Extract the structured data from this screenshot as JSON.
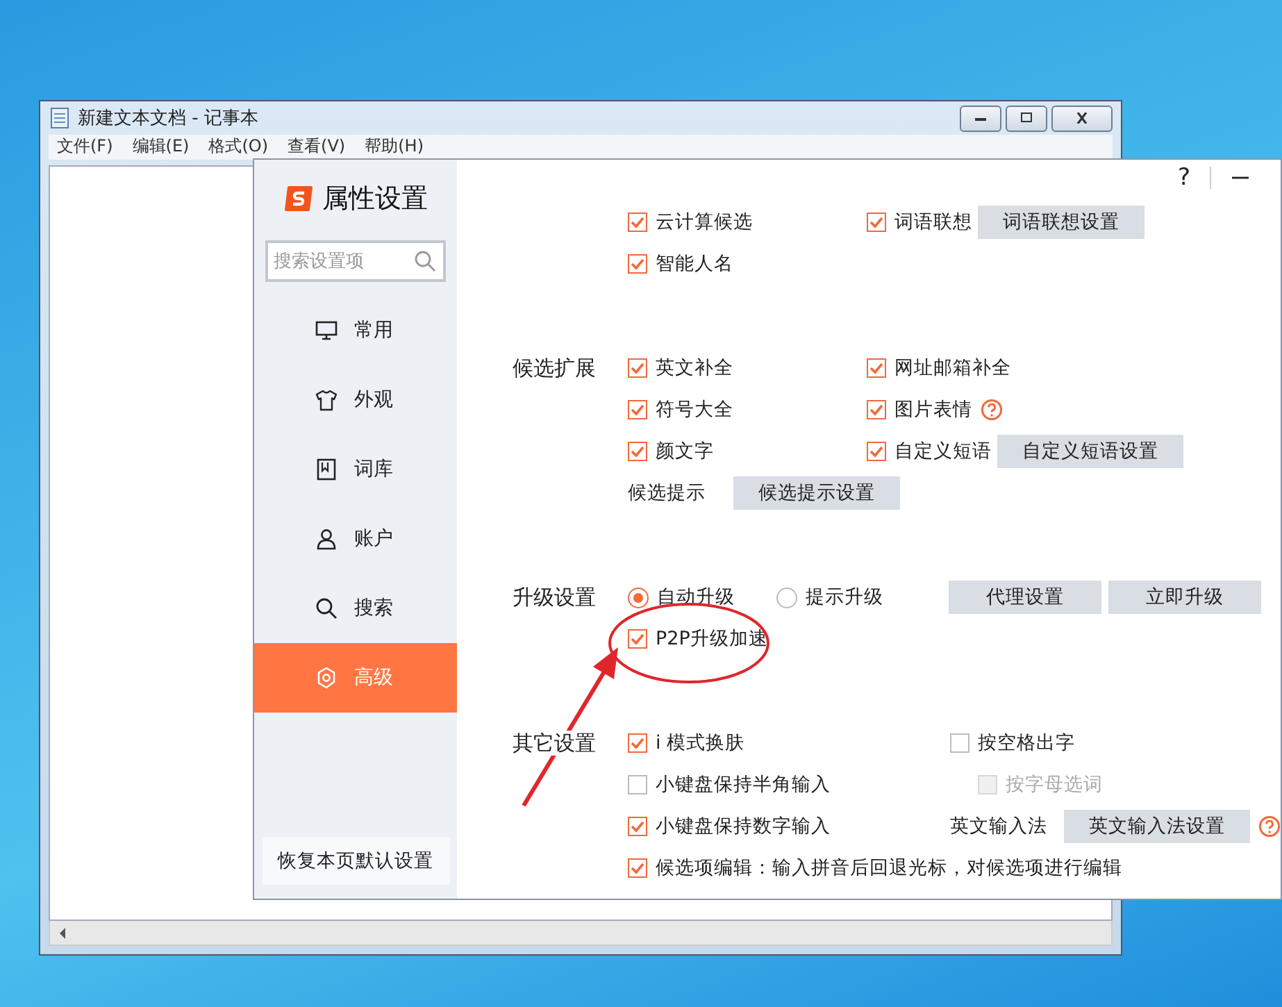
{
  "notepad": {
    "title": "新建文本文档 - 记事本",
    "menu": [
      "文件(F)",
      "编辑(E)",
      "格式(O)",
      "查看(V)",
      "帮助(H)"
    ]
  },
  "dialog": {
    "app_title": "属性设置",
    "search": {
      "placeholder": "搜索设置项"
    },
    "help": "?",
    "nav": [
      {
        "label": "常用",
        "selected": false
      },
      {
        "label": "外观",
        "selected": false
      },
      {
        "label": "词库",
        "selected": false
      },
      {
        "label": "账户",
        "selected": false
      },
      {
        "label": "搜索",
        "selected": false
      },
      {
        "label": "高级",
        "selected": true
      }
    ],
    "reset_button": "恢复本页默认设置"
  },
  "sections": [
    {
      "kind": "cloud",
      "rows": [
        [
          {
            "kind": "checkbox",
            "label": "云计算候选",
            "checked": true
          },
          {
            "kind": "checkbox",
            "label": "词语联想",
            "checked": true
          },
          {
            "kind": "button",
            "label": "词语联想设置"
          }
        ],
        [
          {
            "kind": "checkbox",
            "label": "智能人名",
            "checked": true
          }
        ]
      ]
    },
    {
      "kind": "extend",
      "title": "候选扩展",
      "rows": [
        [
          {
            "kind": "checkbox",
            "label": "英文补全",
            "checked": true
          },
          {
            "kind": "checkbox",
            "label": "网址邮箱补全",
            "checked": true
          }
        ],
        [
          {
            "kind": "checkbox",
            "label": "符号大全",
            "checked": true
          },
          {
            "kind": "checkbox",
            "label": "图片表情",
            "checked": true
          },
          {
            "kind": "help"
          }
        ],
        [
          {
            "kind": "checkbox",
            "label": "颜文字",
            "checked": true
          },
          {
            "kind": "checkbox",
            "label": "自定义短语",
            "checked": true
          },
          {
            "kind": "button",
            "label": "自定义短语设置"
          }
        ],
        [
          {
            "kind": "label",
            "label": "候选提示"
          },
          {
            "kind": "button",
            "label": "候选提示设置"
          }
        ]
      ]
    },
    {
      "kind": "upgrade",
      "title": "升级设置",
      "rows": [
        [
          {
            "kind": "radio",
            "label": "自动升级",
            "selected": true
          },
          {
            "kind": "radio",
            "label": "提示升级",
            "selected": false
          },
          {
            "kind": "button",
            "label": "代理设置"
          },
          {
            "kind": "button",
            "label": "立即升级"
          }
        ],
        [
          {
            "kind": "checkbox",
            "label": "P2P升级加速",
            "checked": true
          }
        ]
      ]
    },
    {
      "kind": "other",
      "title": "其它设置",
      "rows": [
        [
          {
            "kind": "checkbox",
            "label": "i 模式换肤",
            "checked": true
          },
          {
            "kind": "checkbox",
            "label": "按空格出字",
            "checked": false
          }
        ],
        [
          {
            "kind": "checkbox",
            "label": "小键盘保持半角输入",
            "checked": false
          },
          {
            "kind": "checkbox",
            "label": "按字母选词",
            "checked": false,
            "disabled": true
          }
        ],
        [
          {
            "kind": "checkbox",
            "label": "小键盘保持数字输入",
            "checked": true
          },
          {
            "kind": "label",
            "label": "英文输入法"
          },
          {
            "kind": "button",
            "label": "英文输入法设置"
          },
          {
            "kind": "help"
          }
        ],
        [
          {
            "kind": "checkbox",
            "label": "候选项编辑：输入拼音后回退光标，对候选项进行编辑",
            "checked": true
          }
        ]
      ]
    }
  ]
}
